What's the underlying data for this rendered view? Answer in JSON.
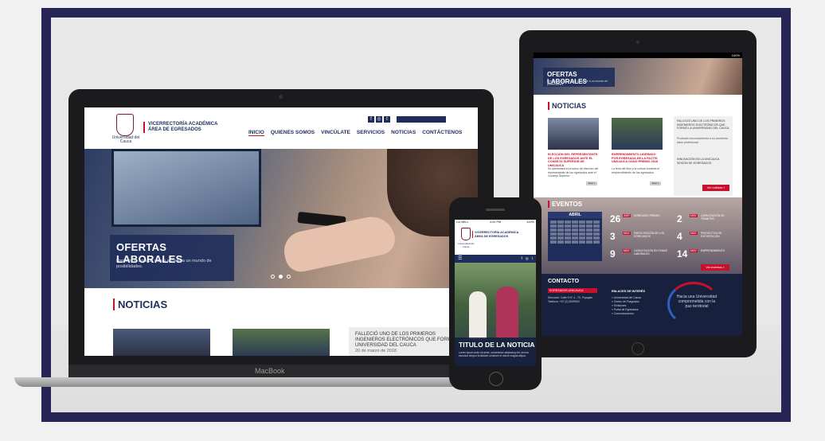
{
  "laptop": {
    "brand": "MacBook",
    "site": {
      "logo_text": "Universidad del Cauca",
      "title_line1": "VICERRECTORÍA ACADÉMICA",
      "title_line2": "ÁREA DE EGRESADOS",
      "social": [
        "f",
        "◎",
        "t"
      ],
      "nav": [
        "INICIO",
        "QUIENES SOMOS",
        "VINCÚLATE",
        "SERVICIOS",
        "NOTICIAS",
        "CONTÁCTENOS"
      ]
    },
    "hero": {
      "title": "OFERTAS LABORALES",
      "description": "Registra tu hoja de vida y accede a un mundo de posibilidades."
    },
    "news": {
      "heading": "NOTICIAS",
      "featured_title": "FALLECIÓ UNO DE LOS PRIMEROS INGENIEROS ELECTRÓNICOS QUE FORMÓ LA UNIVERSIDAD DEL CAUCA",
      "featured_date": "20 de marzo de 2018"
    }
  },
  "tablet": {
    "status": "100%",
    "hero": {
      "title": "OFERTAS LABORALES",
      "description": "Registra tu hoja de vida y accede a un mundo de posibilidades."
    },
    "news": {
      "heading": "NOTICIAS",
      "items": [
        {
          "title": "ELECCIÓN DEL REPRESENTANTE DE LOS EGRESADOS ANTE EL CONSEJO SUPERIOR DE UNICAUCA",
          "desc": "Se adelantará el proceso de elección del representante de los egresados ante el Consejo Superior.",
          "button": "Leer +"
        },
        {
          "title": "EMPRENDIMIENTO LIDERADO POR EGRESADA DE LA FACTIS UNICAUCA GANÓ PREMIO 2018",
          "desc": "La feria del libro y la cultura fomenta el emprendimiento de los egresados.",
          "button": "Leer +"
        }
      ],
      "side_title": "FALLECIÓ UNO DE LOS PRIMEROS INGENIEROS ELECTRÓNICOS QUE FORMÓ LA UNIVERSIDAD DEL CAUCA",
      "side_text": "Profundo reconocimiento a su excelente labor profesional.",
      "side_title2": "INNOVACIÓN EN LA UNICAUCA SESIÓN DE EGRESADOS",
      "side_button": "Ver noticias »"
    },
    "events": {
      "heading": "EVENTOS",
      "month": "ABRIL",
      "items": [
        {
          "day": "26",
          "month": "ABR",
          "text": "EGRESADO PREMIO"
        },
        {
          "day": "2",
          "month": "MAY",
          "text": "CAPACITACIÓN DE TRAMITES"
        },
        {
          "day": "3",
          "month": "MAY",
          "text": "PARTICIPACIÓN DE LOS EGRESADOS"
        },
        {
          "day": "4",
          "month": "MAY",
          "text": "PROYECTOS DE EXPORTACIÓN"
        },
        {
          "day": "9",
          "month": "MAY",
          "text": "CAPACITACIÓN EN TEMAS LABORALES"
        },
        {
          "day": "14",
          "month": "MAY",
          "text": "EMPRENDIMIENTO"
        }
      ],
      "button": "Ver eventos »"
    },
    "contact": {
      "heading": "CONTACTO",
      "badge": "EGRESADOS UNICAUCA",
      "address": "Dirección: Calle 5 N° 4 - 70, Popayán",
      "phone": "Teléfono: +57 (2) 8209900",
      "links_heading": "ENLACES DE INTERÉS",
      "links": [
        "» Universidad del Cauca",
        "» Centro de Posgrados",
        "» Divisiones",
        "» Portal de Egresados",
        "» Comunicaciones"
      ],
      "footer_text": "Hacia una Universidad comprometida con la paz territorial"
    }
  },
  "phone": {
    "status_left": "•••• BELL",
    "status_time": "4:20 PM",
    "status_right": "100%",
    "logo_text": "Universidad del Cauca",
    "title_line1": "VICERRECTORÍA ACADÉMICA",
    "title_line2": "ÁREA DE EGRESADOS",
    "menu_icon": "☰",
    "social": [
      "f",
      "◎",
      "t"
    ],
    "hero": {
      "title": "TITULO DE LA NOTICIA",
      "description": "Lorem ipsum dolor sit amet, consectetur adipiscing elit, sed do eiusmod tempor incididunt ut labore et dolore magna aliqua."
    }
  }
}
